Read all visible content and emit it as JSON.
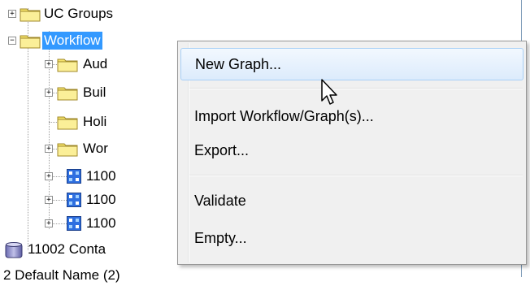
{
  "tree": {
    "items": [
      {
        "label": "UC Groups"
      },
      {
        "label": "Workflow"
      },
      {
        "label": "Aud"
      },
      {
        "label": "Buil"
      },
      {
        "label": "Holi"
      },
      {
        "label": "Wor"
      },
      {
        "label": "1100"
      },
      {
        "label": "1100"
      },
      {
        "label": "1100"
      },
      {
        "label": "11002 Conta"
      },
      {
        "label": "2 Default Name (2)"
      }
    ]
  },
  "context_menu": {
    "items": [
      {
        "label": "New Graph..."
      },
      {
        "label": "Import Workflow/Graph(s)..."
      },
      {
        "label": "Export..."
      },
      {
        "label": "Validate"
      },
      {
        "label": "Empty..."
      }
    ]
  },
  "colors": {
    "selection": "#3399ff",
    "menu_hover_border": "#a8d0f7",
    "folder_yellow": "#f5e26a"
  }
}
